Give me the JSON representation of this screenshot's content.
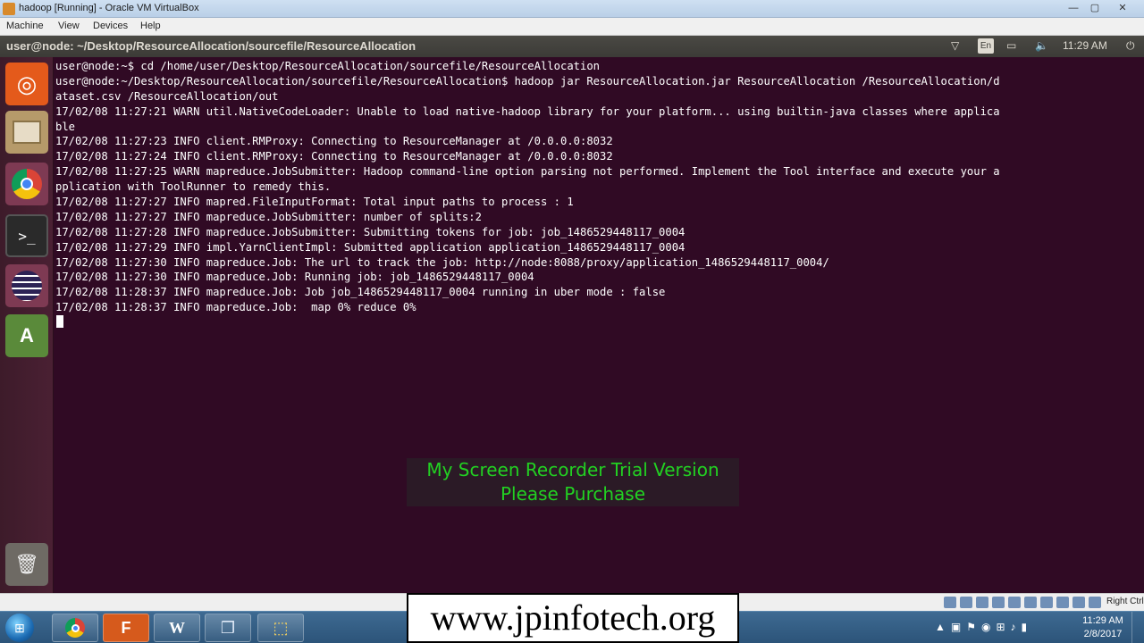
{
  "vbox": {
    "title": "hadoop [Running] - Oracle VM VirtualBox",
    "window_buttons": [
      "—",
      "▢",
      "✕"
    ],
    "menu": [
      "Machine",
      "View",
      "Devices",
      "Help"
    ],
    "status_hostkey": "Right Ctrl"
  },
  "ubuntu": {
    "panel_title": "user@node: ~/Desktop/ResourceAllocation/sourcefile/ResourceAllocation",
    "indicators": {
      "wifi": "▽",
      "lang": "En",
      "battery": "▭",
      "volume": "🔈",
      "time": "11:29 AM",
      "power": "⏻"
    },
    "launcher": [
      {
        "name": "ubuntu-dash-icon",
        "glyph": "◎"
      },
      {
        "name": "files-icon",
        "glyph": ""
      },
      {
        "name": "chrome-icon",
        "glyph": ""
      },
      {
        "name": "terminal-icon",
        "glyph": ">_"
      },
      {
        "name": "eclipse-icon",
        "glyph": ""
      },
      {
        "name": "software-updater-icon",
        "glyph": "A"
      },
      {
        "name": "trash-icon",
        "glyph": "🗑"
      }
    ]
  },
  "terminal": {
    "lines": [
      "user@node:~$ cd /home/user/Desktop/ResourceAllocation/sourcefile/ResourceAllocation",
      "user@node:~/Desktop/ResourceAllocation/sourcefile/ResourceAllocation$ hadoop jar ResourceAllocation.jar ResourceAllocation /ResourceAllocation/d",
      "ataset.csv /ResourceAllocation/out",
      "17/02/08 11:27:21 WARN util.NativeCodeLoader: Unable to load native-hadoop library for your platform... using builtin-java classes where applica",
      "ble",
      "17/02/08 11:27:23 INFO client.RMProxy: Connecting to ResourceManager at /0.0.0.0:8032",
      "17/02/08 11:27:24 INFO client.RMProxy: Connecting to ResourceManager at /0.0.0.0:8032",
      "17/02/08 11:27:25 WARN mapreduce.JobSubmitter: Hadoop command-line option parsing not performed. Implement the Tool interface and execute your a",
      "pplication with ToolRunner to remedy this.",
      "17/02/08 11:27:27 INFO mapred.FileInputFormat: Total input paths to process : 1",
      "17/02/08 11:27:27 INFO mapreduce.JobSubmitter: number of splits:2",
      "17/02/08 11:27:28 INFO mapreduce.JobSubmitter: Submitting tokens for job: job_1486529448117_0004",
      "17/02/08 11:27:29 INFO impl.YarnClientImpl: Submitted application application_1486529448117_0004",
      "17/02/08 11:27:30 INFO mapreduce.Job: The url to track the job: http://node:8088/proxy/application_1486529448117_0004/",
      "17/02/08 11:27:30 INFO mapreduce.Job: Running job: job_1486529448117_0004",
      "17/02/08 11:28:37 INFO mapreduce.Job: Job job_1486529448117_0004 running in uber mode : false",
      "17/02/08 11:28:37 INFO mapreduce.Job:  map 0% reduce 0%"
    ]
  },
  "watermark": {
    "trial_line1": "My Screen Recorder Trial Version",
    "trial_line2": "Please Purchase",
    "site": "www.jpinfotech.org"
  },
  "windows_taskbar": {
    "start": "⊞",
    "buttons": [
      {
        "name": "taskbar-chrome-button"
      },
      {
        "name": "taskbar-file-button",
        "glyph": "F"
      },
      {
        "name": "taskbar-word-button",
        "glyph": "W"
      },
      {
        "name": "taskbar-virtualbox-button",
        "glyph": "❒"
      },
      {
        "name": "taskbar-recorder-button",
        "glyph": "⬚"
      }
    ],
    "tray_show_hidden": "▲",
    "clock_time": "11:29 AM",
    "clock_date": "2/8/2017"
  },
  "colors": {
    "terminal_bg": "#300a24",
    "launcher_bg": "#4a2033",
    "watermark_green": "#22d122"
  }
}
